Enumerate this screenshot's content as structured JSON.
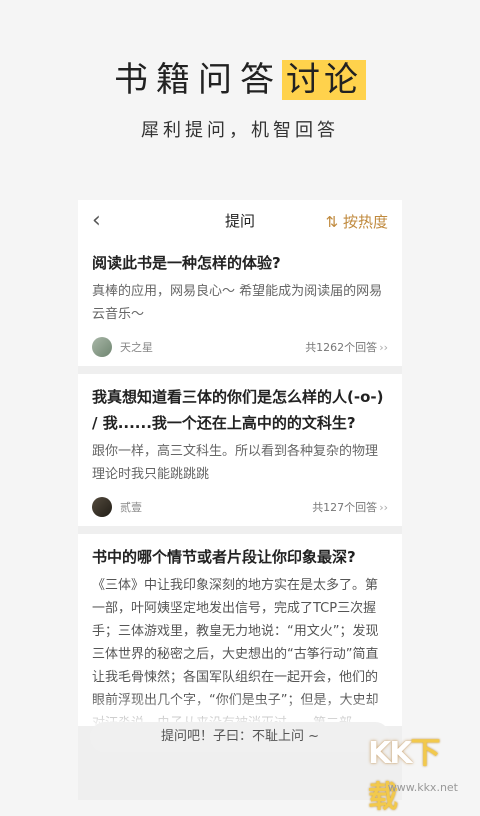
{
  "promo": {
    "title_main": "书籍问答",
    "title_highlight": "讨论",
    "subtitle": "犀利提问，机智回答"
  },
  "nav": {
    "back_icon": "chevron-left",
    "title": "提问",
    "sort_label": "⇅ 按热度"
  },
  "questions": [
    {
      "title": "阅读此书是一种怎样的体验?",
      "answer": "真棒的应用，网易良心～ 希望能成为阅读届的网易云音乐～",
      "user": "天之星",
      "count": "共1262个回答"
    },
    {
      "title": "我真想知道看三体的你们是怎么样的人(-o-) / 我......我一个还在上高中的的文科生?",
      "answer": "跟你一样，高三文科生。所以看到各种复杂的物理理论时我只能跳跳跳",
      "user": "贰壹",
      "count": "共127个回答"
    },
    {
      "title": "书中的哪个情节或者片段让你印象最深?",
      "answer": "《三体》中让我印象深刻的地方实在是太多了。第一部，叶阿姨坚定地发出信号，完成了TCP三次握手；三体游戏里，教皇无力地说：“用文火”；发现三体世界的秘密之后，大史想出的“古筝行动”简直让我毛骨悚然；各国军队组织在一起开会，他们的眼前浮现出几个字，“你们是虫子”；但是，大史却对汪淼说，虫子从来没有被消灭过……第二部"
    }
  ],
  "input": {
    "placeholder": "提问吧！子曰：不耻上问 ~"
  },
  "watermark": {
    "logo_a": "KK",
    "logo_b": "下载",
    "url": "www.kkx.net"
  }
}
